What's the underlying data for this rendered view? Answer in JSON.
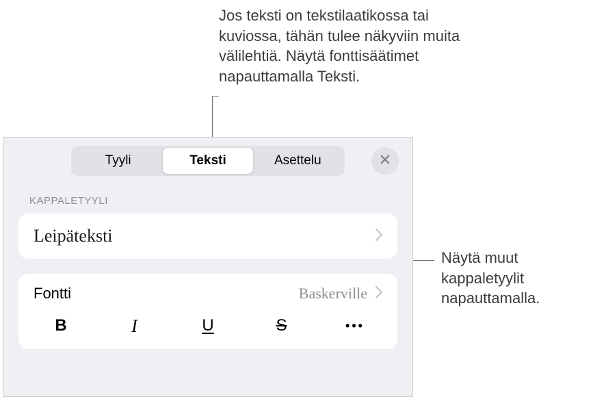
{
  "annotations": {
    "top": "Jos teksti on tekstilaatikossa tai kuviossa, tähän tulee näkyviin muita välilehtiä. Näytä fonttisäätimet napauttamalla Teksti.",
    "right": "Näytä muut kappaletyylit napauttamalla."
  },
  "tabs": {
    "style": "Tyyli",
    "text": "Teksti",
    "layout": "Asettelu"
  },
  "section_title": "KAPPALETYYLI",
  "paragraph_style": {
    "name": "Leipäteksti"
  },
  "font": {
    "label": "Fontti",
    "value": "Baskerville"
  },
  "style_buttons": {
    "bold": "B",
    "italic": "I",
    "underline": "U",
    "strike": "S",
    "more": "•••"
  },
  "icons": {
    "close": "close-icon",
    "chevron": "chevron-right-icon"
  }
}
